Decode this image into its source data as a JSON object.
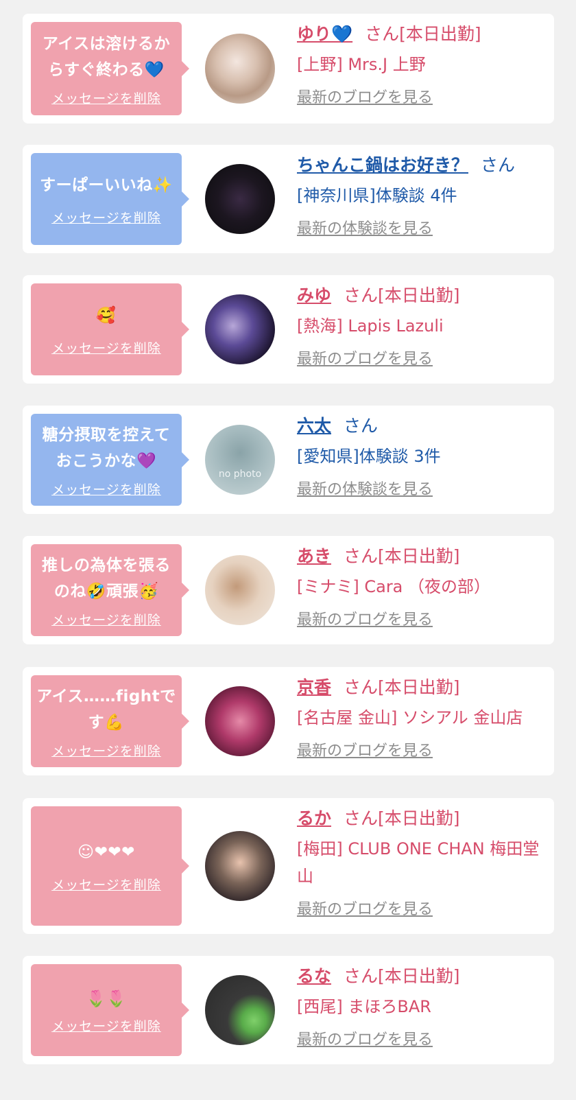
{
  "delete_label": "メッセージを削除",
  "colors": {
    "pink_bubble": "#f0a2ae",
    "blue_bubble": "#94b6ee",
    "pink_text": "#d64c6a",
    "blue_text": "#1f5aa8"
  },
  "items": [
    {
      "message": "アイスは溶けるからすぐ終わる💙",
      "name": "ゆり💙",
      "suffix": "さん[本日出勤]",
      "shop": "[上野] Mrs.J 上野",
      "link": "最新のブログを見る"
    },
    {
      "message": "すーぱーいいね✨",
      "name": "ちゃんこ鍋はお好き？",
      "suffix": "さん",
      "shop": "[神奈川県]体験談 4件",
      "link": "最新の体験談を見る"
    },
    {
      "message": "🥰",
      "name": "みゆ",
      "suffix": "さん[本日出勤]",
      "shop": "[熱海] Lapis Lazuli",
      "link": "最新のブログを見る"
    },
    {
      "message": "糖分摂取を控えておこうかな💜",
      "name": "六太",
      "suffix": "さん",
      "shop": "[愛知県]体験談 3件",
      "link": "最新の体験談を見る",
      "avatar_text": "no photo"
    },
    {
      "message": "推しの為体を張るのね🤣頑張🥳",
      "name": "あき",
      "suffix": "さん[本日出勤]",
      "shop": "[ミナミ] Cara （夜の部）",
      "link": "最新のブログを見る"
    },
    {
      "message": "アイス……fightです💪",
      "name": "京香",
      "suffix": "さん[本日出勤]",
      "shop": "[名古屋 金山] ソシアル 金山店",
      "link": "最新のブログを見る"
    },
    {
      "message": "☺❤❤❤",
      "name": "るか",
      "suffix": "さん[本日出勤]",
      "shop": "[梅田] CLUB ONE CHAN 梅田堂山",
      "link": "最新のブログを見る"
    },
    {
      "message": "🌷🌷",
      "name": "るな",
      "suffix": "さん[本日出勤]",
      "shop": "[西尾] まほろBAR",
      "link": "最新のブログを見る"
    }
  ]
}
